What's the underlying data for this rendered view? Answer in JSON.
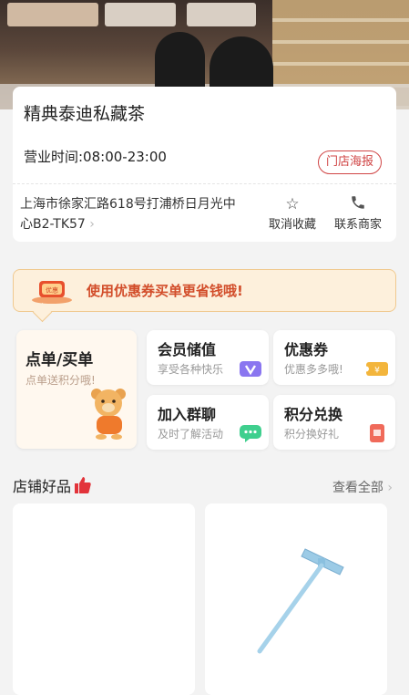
{
  "store": {
    "name": "精典泰迪私藏茶",
    "hours": "营业时间:08:00-23:00",
    "poster_button": "门店海报",
    "address": "上海市徐家汇路618号打浦桥日月光中心B2-TK57",
    "favorite_label": "取消收藏",
    "contact_label": "联系商家"
  },
  "coupon_banner": {
    "icon_text": "优惠",
    "text": "使用优惠券买单更省钱哦!"
  },
  "features": {
    "order": {
      "title": "点单/买单",
      "subtitle": "点单送积分哦!"
    },
    "member": {
      "title": "会员储值",
      "subtitle": "享受各种快乐"
    },
    "coupon": {
      "title": "优惠券",
      "subtitle": "优惠多多哦!"
    },
    "group": {
      "title": "加入群聊",
      "subtitle": "及时了解活动"
    },
    "points": {
      "title": "积分兑换",
      "subtitle": "积分换好礼"
    }
  },
  "products_section": {
    "title": "店铺好品",
    "see_all": "查看全部"
  },
  "colors": {
    "accent_red": "#d04545",
    "coupon_text": "#d24d2a",
    "coupon_bg": "#fdf0dc"
  }
}
